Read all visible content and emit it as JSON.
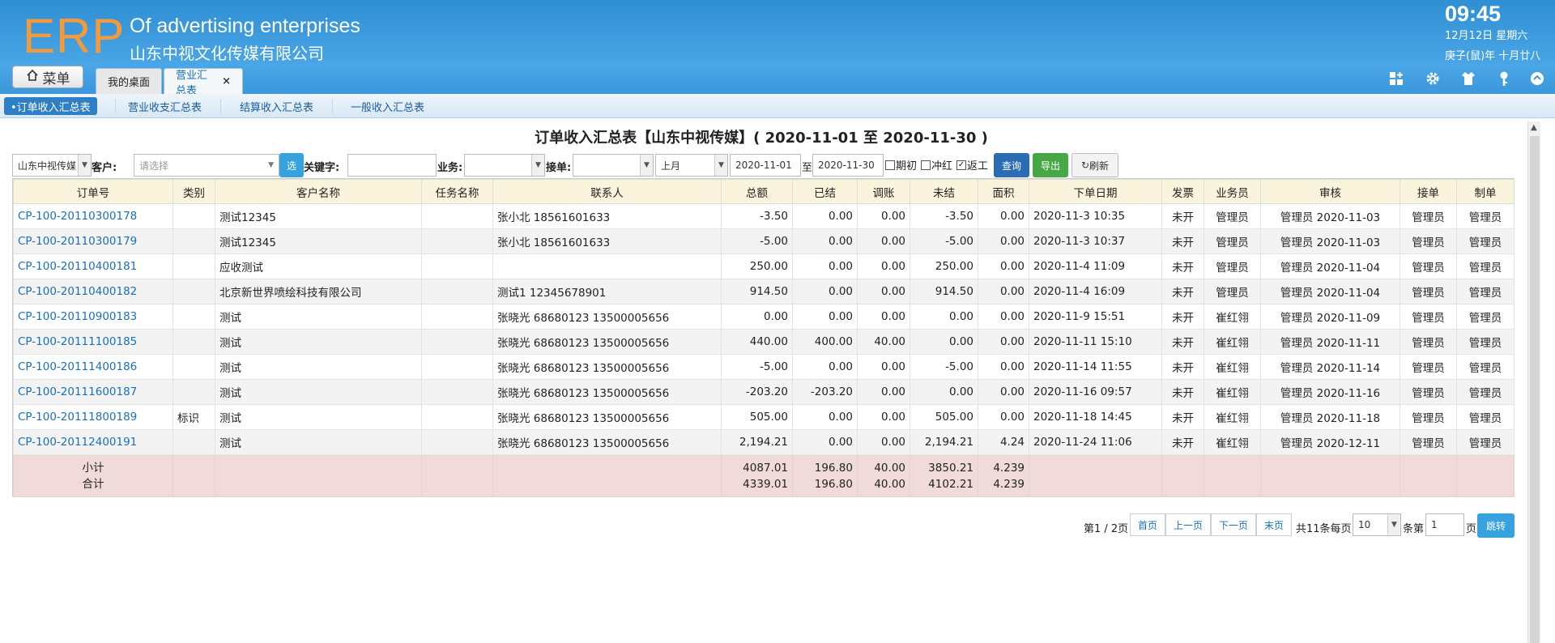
{
  "header": {
    "logo": "ERP",
    "tagline": "Of advertising enterprises",
    "company": "山东中视文化传媒有限公司",
    "time": "09:45",
    "date": "12月12日 星期六",
    "lunar": "庚子(鼠)年 十月廿八",
    "menu_label": "菜单"
  },
  "tabs": [
    {
      "label": "我的桌面"
    },
    {
      "label": "营业汇总表",
      "close": "×"
    }
  ],
  "subnav": [
    "•订单收入汇总表",
    "营业收支汇总表",
    "结算收入汇总表",
    "一般收入汇总表"
  ],
  "report_title": "订单收入汇总表【山东中视传媒】( 2020-11-01 至 2020-11-30 )",
  "filters": {
    "company_value": "山东中视传媒",
    "customer_label": "客户:",
    "customer_placeholder": "请选择",
    "select_button": "选",
    "keyword_label": "关键字:",
    "business_label": "业务:",
    "taker_label": "接单:",
    "period_value": "上月",
    "date_from": "2020-11-01",
    "date_to_label": "至",
    "date_to": "2020-11-30",
    "chk_opening": "期初",
    "chk_reverse": "冲红",
    "chk_rework": "返工",
    "chk_rework_checked": true,
    "query_button": "查询",
    "export_button": "导出",
    "refresh_button": "刷新"
  },
  "columns": [
    "订单号",
    "类别",
    "客户名称",
    "任务名称",
    "联系人",
    "总额",
    "已结",
    "调账",
    "未结",
    "面积",
    "下单日期",
    "发票",
    "业务员",
    "审核",
    "接单",
    "制单"
  ],
  "rows": [
    [
      "CP-100-20110300178",
      "",
      "测试12345",
      "",
      "张小北 18561601633",
      "-3.50",
      "0.00",
      "0.00",
      "-3.50",
      "0.00",
      "2020-11-3 10:35",
      "未开",
      "管理员",
      "管理员 2020-11-03",
      "管理员",
      "管理员"
    ],
    [
      "CP-100-20110300179",
      "",
      "测试12345",
      "",
      "张小北 18561601633",
      "-5.00",
      "0.00",
      "0.00",
      "-5.00",
      "0.00",
      "2020-11-3 10:37",
      "未开",
      "管理员",
      "管理员 2020-11-03",
      "管理员",
      "管理员"
    ],
    [
      "CP-100-20110400181",
      "",
      "应收测试",
      "",
      "",
      "250.00",
      "0.00",
      "0.00",
      "250.00",
      "0.00",
      "2020-11-4 11:09",
      "未开",
      "管理员",
      "管理员 2020-11-04",
      "管理员",
      "管理员"
    ],
    [
      "CP-100-20110400182",
      "",
      "北京新世界喷绘科技有限公司",
      "",
      "测试1 12345678901",
      "914.50",
      "0.00",
      "0.00",
      "914.50",
      "0.00",
      "2020-11-4 16:09",
      "未开",
      "管理员",
      "管理员 2020-11-04",
      "管理员",
      "管理员"
    ],
    [
      "CP-100-20110900183",
      "",
      "测试",
      "",
      "张晓光 68680123 13500005656",
      "0.00",
      "0.00",
      "0.00",
      "0.00",
      "0.00",
      "2020-11-9 15:51",
      "未开",
      "崔红翎",
      "管理员 2020-11-09",
      "管理员",
      "管理员"
    ],
    [
      "CP-100-20111100185",
      "",
      "测试",
      "",
      "张晓光 68680123 13500005656",
      "440.00",
      "400.00",
      "40.00",
      "0.00",
      "0.00",
      "2020-11-11 15:10",
      "未开",
      "崔红翎",
      "管理员 2020-11-11",
      "管理员",
      "管理员"
    ],
    [
      "CP-100-20111400186",
      "",
      "测试",
      "",
      "张晓光 68680123 13500005656",
      "-5.00",
      "0.00",
      "0.00",
      "-5.00",
      "0.00",
      "2020-11-14 11:55",
      "未开",
      "崔红翎",
      "管理员 2020-11-14",
      "管理员",
      "管理员"
    ],
    [
      "CP-100-20111600187",
      "",
      "测试",
      "",
      "张晓光 68680123 13500005656",
      "-203.20",
      "-203.20",
      "0.00",
      "0.00",
      "0.00",
      "2020-11-16 09:57",
      "未开",
      "崔红翎",
      "管理员 2020-11-16",
      "管理员",
      "管理员"
    ],
    [
      "CP-100-20111800189",
      "标识",
      "测试",
      "",
      "张晓光 68680123 13500005656",
      "505.00",
      "0.00",
      "0.00",
      "505.00",
      "0.00",
      "2020-11-18 14:45",
      "未开",
      "崔红翎",
      "管理员 2020-11-18",
      "管理员",
      "管理员"
    ],
    [
      "CP-100-20112400191",
      "",
      "测试",
      "",
      "张晓光 68680123 13500005656",
      "2,194.21",
      "0.00",
      "0.00",
      "2,194.21",
      "4.24",
      "2020-11-24 11:06",
      "未开",
      "崔红翎",
      "管理员 2020-12-11",
      "管理员",
      "管理员"
    ]
  ],
  "summary": {
    "subtotal_label": "小计",
    "total_label": "合计",
    "subtotal": [
      "4087.01",
      "196.80",
      "40.00",
      "3850.21",
      "4.239"
    ],
    "total": [
      "4339.01",
      "196.80",
      "40.00",
      "4102.21",
      "4.239"
    ]
  },
  "pager": {
    "page_info": "第1 / 2页",
    "first": "首页",
    "prev": "上一页",
    "next": "下一页",
    "last": "末页",
    "total_text": "共11条每页",
    "page_size": "10",
    "goto_prefix": "条第",
    "goto_value": "1",
    "goto_suffix": "页",
    "goto_button": "跳转"
  },
  "colors": {
    "header_blue": "#3b97da",
    "logo_orange": "#f39a3c",
    "active_tab": "#2f7fc6",
    "link": "#1a6fb8",
    "summary_bg": "#f1dada",
    "header_row_bg": "#fbf4dc"
  }
}
